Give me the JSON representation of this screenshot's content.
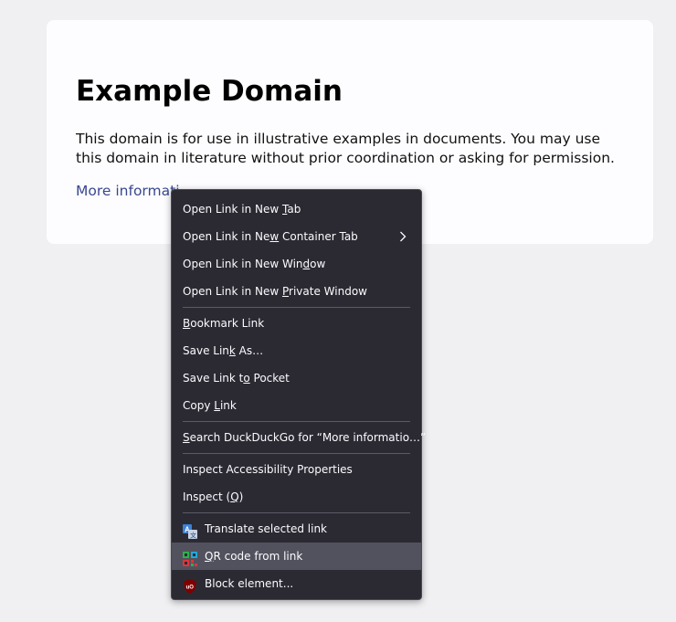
{
  "page": {
    "title": "Example Domain",
    "description": "This domain is for use in illustrative examples in documents. You may use this domain in literature without prior coordination or asking for permission.",
    "link_text": "More informati"
  },
  "menu": {
    "groups": [
      [
        {
          "pre": "Open Link in New ",
          "acc": "T",
          "post": "ab",
          "name": "menu-open-link-new-tab"
        },
        {
          "pre": "Open Link in Ne",
          "acc": "w",
          "post": " Container Tab",
          "name": "menu-open-link-container-tab",
          "submenu": true
        },
        {
          "pre": "Open Link in New Win",
          "acc": "d",
          "post": "ow",
          "name": "menu-open-link-new-window"
        },
        {
          "pre": "Open Link in New ",
          "acc": "P",
          "post": "rivate Window",
          "name": "menu-open-link-private-window"
        }
      ],
      [
        {
          "pre": "",
          "acc": "B",
          "post": "ookmark Link",
          "name": "menu-bookmark-link"
        },
        {
          "pre": "Save Lin",
          "acc": "k",
          "post": " As…",
          "name": "menu-save-link-as"
        },
        {
          "pre": "Save Link t",
          "acc": "o",
          "post": " Pocket",
          "name": "menu-save-link-pocket"
        },
        {
          "pre": "Copy ",
          "acc": "L",
          "post": "ink",
          "name": "menu-copy-link"
        }
      ],
      [
        {
          "pre": "",
          "acc": "S",
          "post": "earch DuckDuckGo for “More informatio…”",
          "name": "menu-search-duckduckgo"
        }
      ],
      [
        {
          "pre": "Inspect Accessibility Properties",
          "acc": "",
          "post": "",
          "name": "menu-inspect-accessibility"
        },
        {
          "pre": "Inspect (",
          "acc": "Q",
          "post": ")",
          "name": "menu-inspect"
        }
      ],
      [
        {
          "pre": "Translate selected link",
          "acc": "",
          "post": "",
          "name": "menu-translate-link",
          "icon": "translate-icon"
        },
        {
          "pre": "",
          "acc": "Q",
          "post": "R code from link",
          "name": "menu-qr-code",
          "icon": "qr-code-icon",
          "hover": true
        },
        {
          "pre": "Block element...",
          "acc": "",
          "post": "",
          "name": "menu-block-element",
          "icon": "ublock-icon"
        }
      ]
    ]
  },
  "colors": {
    "menu_bg": "#2b2a33",
    "menu_hover": "#52525e",
    "link": "#38488f"
  }
}
